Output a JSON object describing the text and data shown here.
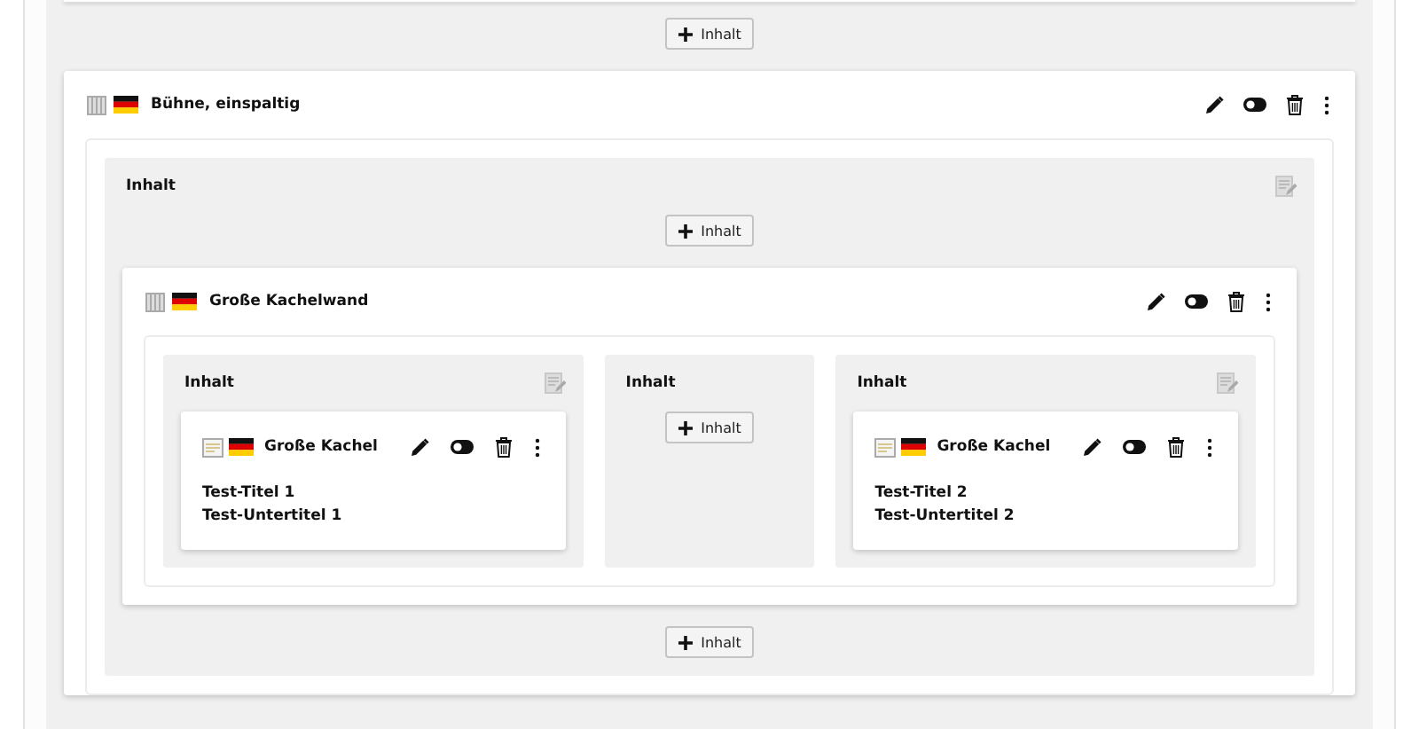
{
  "top_add_button": "Inhalt",
  "elements": [
    {
      "kind": "grid",
      "title": "Bühne, einspaltig",
      "visible": true,
      "columns": [
        {
          "label": "Inhalt",
          "editable": true,
          "items": [
            {
              "kind": "add",
              "label": "Inhalt"
            },
            {
              "kind": "grid",
              "title": "Große Kachelwand",
              "visible": true,
              "columns": [
                {
                  "label": "Inhalt",
                  "editable": true,
                  "items": [
                    {
                      "kind": "tile",
                      "title": "Große Kachel",
                      "visible": true,
                      "lines": [
                        "Test-Titel 1",
                        "Test-Untertitel 1"
                      ]
                    }
                  ]
                },
                {
                  "label": "Inhalt",
                  "editable": false,
                  "items": [
                    {
                      "kind": "add",
                      "label": "Inhalt"
                    }
                  ]
                },
                {
                  "label": "Inhalt",
                  "editable": true,
                  "items": [
                    {
                      "kind": "tile",
                      "title": "Große Kachel",
                      "visible": true,
                      "lines": [
                        "Test-Titel 2",
                        "Test-Untertitel 2"
                      ]
                    }
                  ]
                }
              ]
            },
            {
              "kind": "add",
              "label": "Inhalt"
            }
          ]
        }
      ]
    }
  ]
}
